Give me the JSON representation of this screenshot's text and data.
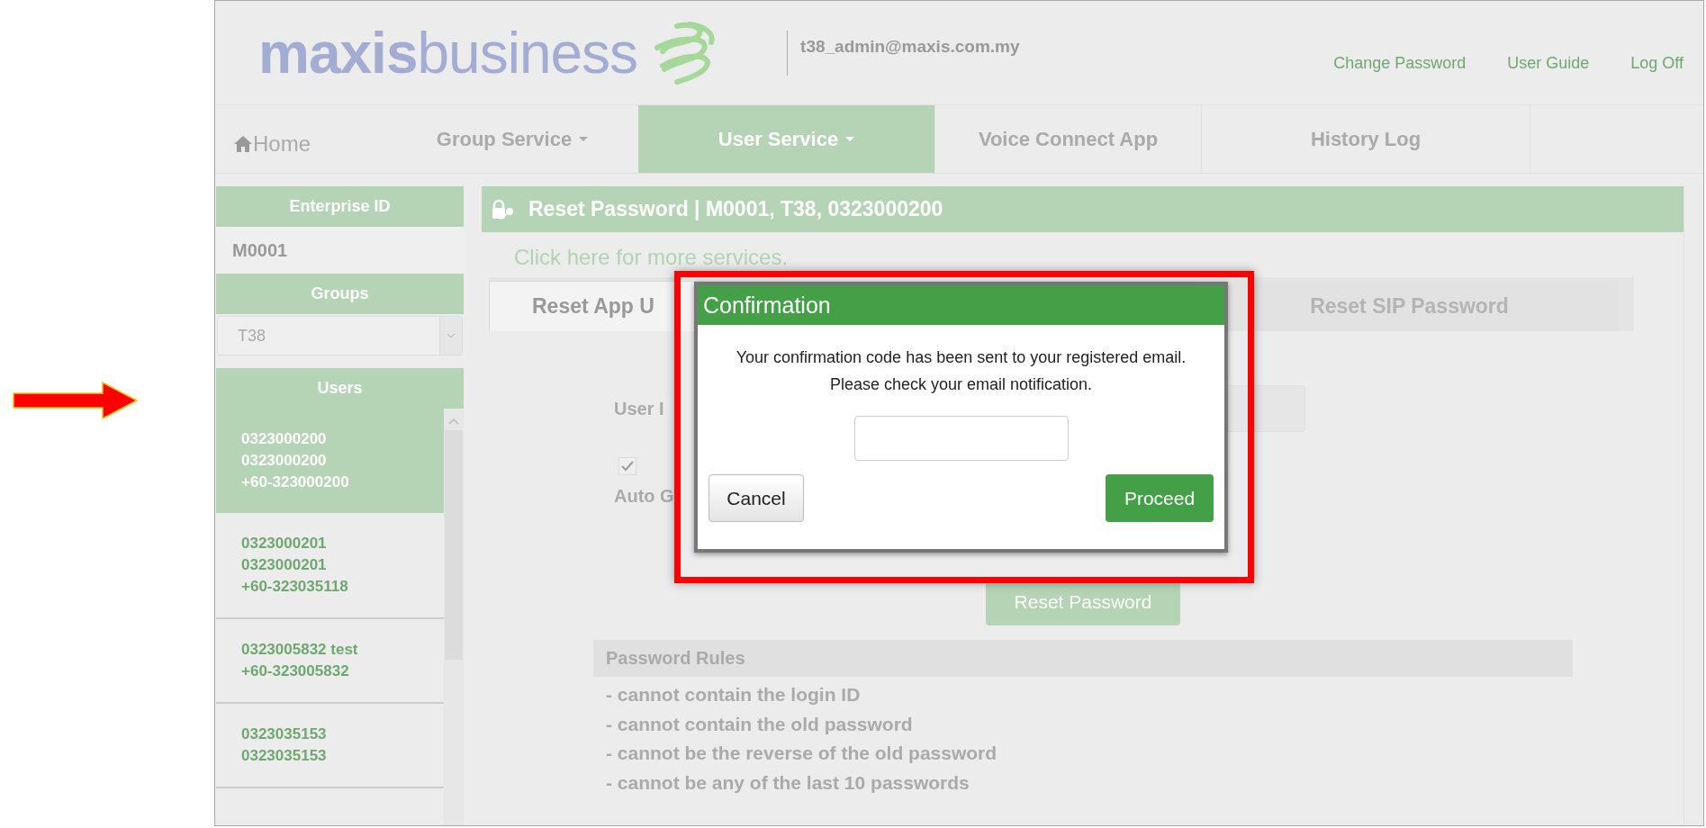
{
  "header": {
    "logo": "**maxis**business",
    "user_email": "t38_admin@maxis.com.my",
    "links": [
      "Change Password",
      "User Guide",
      "Log Off"
    ]
  },
  "nav": [
    {
      "kind": "home",
      "label": "Home",
      "selected": false
    },
    {
      "kind": "menu",
      "label": "Group Service",
      "selected": false
    },
    {
      "kind": "menu",
      "label": "User Service",
      "selected": true
    },
    {
      "kind": "tab",
      "label": "Voice Connect App",
      "selected": false
    },
    {
      "kind": "tab",
      "label": "History Log",
      "selected": false
    }
  ],
  "sidebar": {
    "enterprise_label": "Enterprise ID",
    "enterprise_id": "M0001",
    "groups_label": "Groups",
    "group_select": {
      "value": "T38"
    },
    "users_label": "Users",
    "users": [
      {
        "lines": [
          "0323000200",
          "0323000200",
          "+60-323000200"
        ],
        "selected": true
      },
      {
        "lines": [
          "0323000201",
          "0323000201",
          "+60-323035118"
        ],
        "selected": false
      },
      {
        "lines": [
          "0323005832 test",
          "+60-323005832"
        ],
        "selected": false
      },
      {
        "lines": [
          "0323035153",
          "0323035153"
        ],
        "selected": false
      }
    ]
  },
  "panel": {
    "title": "Reset Password | M0001, T38, 0323000200",
    "more_link": "Click here for more services.",
    "tabs": [
      {
        "label": "Reset App U",
        "selected": true
      },
      {
        "label": "Reset SIP Password",
        "selected": false
      }
    ],
    "user_id_label": "User I",
    "auto_checked": true,
    "auto_label": "Auto G",
    "reset_button": "Reset Password",
    "rules_title": "Password Rules",
    "rules": [
      "- cannot contain the login ID",
      "- cannot contain the old password",
      "- cannot be the reverse of the old password",
      "- cannot be any of the last 10 passwords"
    ]
  },
  "dialog": {
    "title": "Confirmation",
    "message": "Your confirmation code has been sent to your registered email.\nPlease check your email notification.",
    "cancel": "Cancel",
    "proceed": "Proceed"
  }
}
